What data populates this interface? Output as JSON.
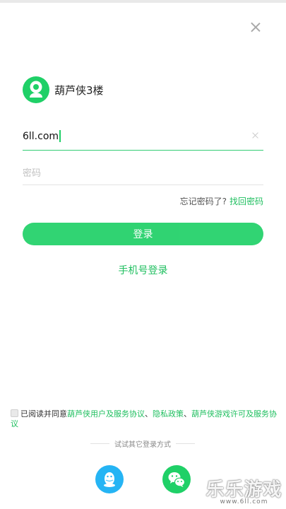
{
  "app": {
    "title": "葫芦侠3楼"
  },
  "form": {
    "account_value": "6ll.com",
    "password_placeholder": "密码"
  },
  "forgot": {
    "text": "忘记密码了?",
    "link": "找回密码"
  },
  "buttons": {
    "login": "登录",
    "phone_login": "手机号登录"
  },
  "agreement": {
    "prefix": "已阅读并同意",
    "user_agreement": "葫芦侠用户及服务协议",
    "sep1": "、",
    "privacy": "隐私政策",
    "sep2": "、",
    "game_license": "葫芦侠游戏许可及服务协议"
  },
  "other_login": {
    "label": "试试其它登录方式"
  },
  "watermark": {
    "title": "乐乐游戏",
    "url": "www.6ll.com"
  },
  "icons": {
    "close": "close-icon",
    "logo": "gourd-logo-icon",
    "clear": "clear-icon",
    "qq": "qq-icon",
    "wechat": "wechat-icon"
  },
  "colors": {
    "accent": "#1fd067",
    "link": "#1fbf5f",
    "qq": "#25b4f4"
  }
}
